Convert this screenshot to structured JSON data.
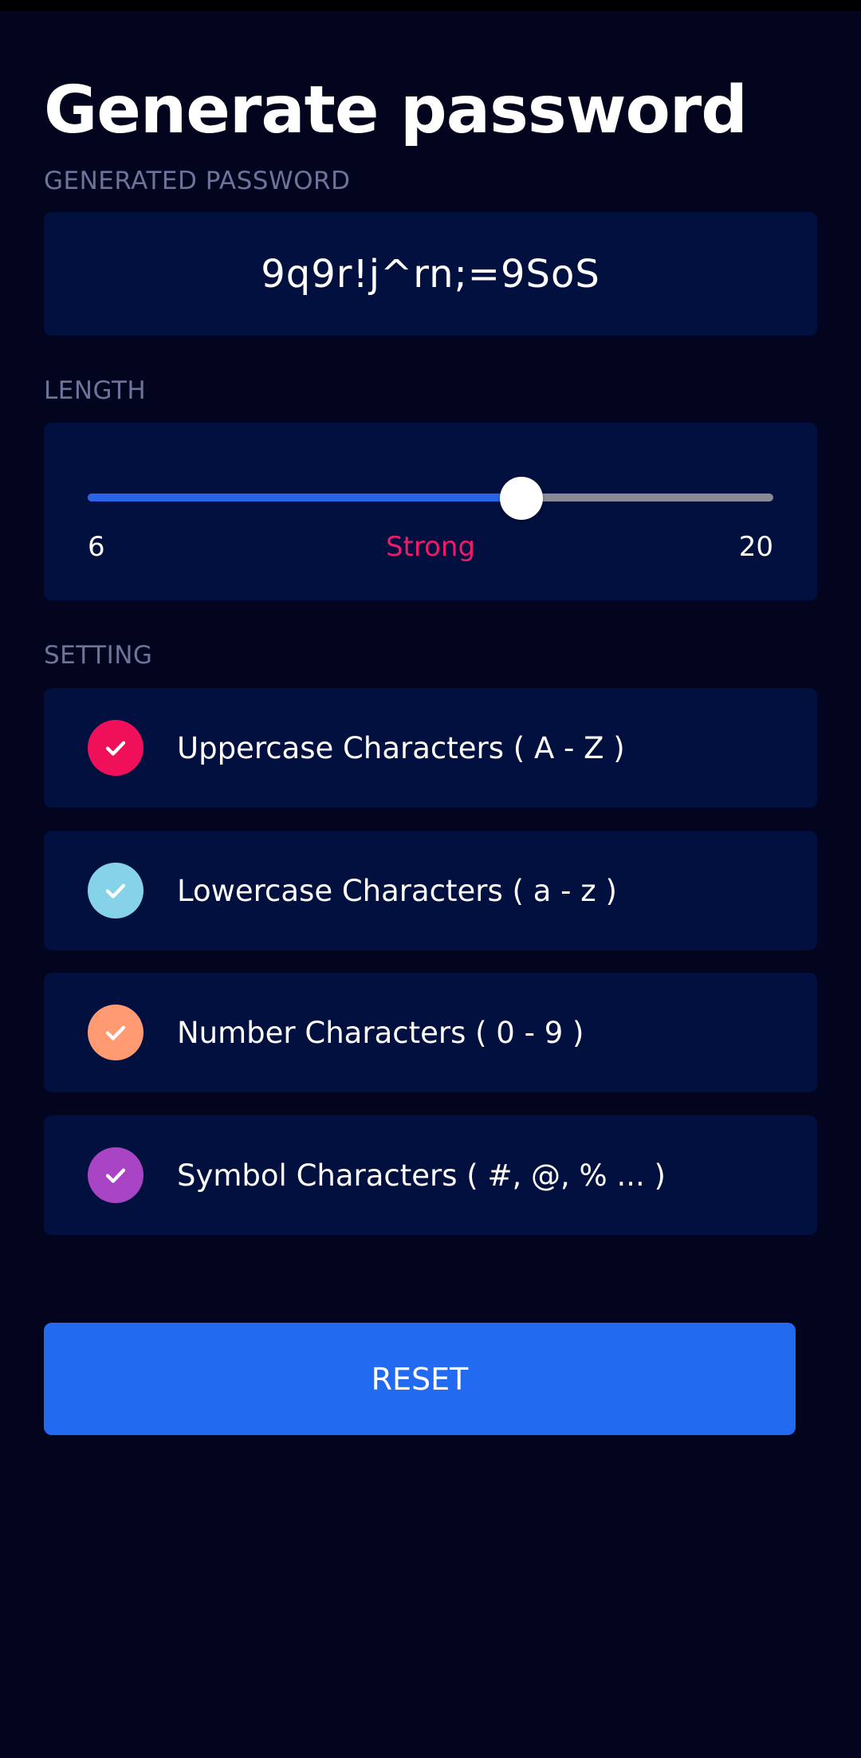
{
  "title": "Generate password",
  "generated": {
    "label": "GENERATED PASSWORD",
    "password": "9q9r!j^rn;=9SoS"
  },
  "length": {
    "label": "LENGTH",
    "min": "6",
    "max": "20",
    "strength": "Strong",
    "value_fraction": 0.633,
    "strength_color": "#f0196a"
  },
  "setting": {
    "label": "SETTING",
    "items": [
      {
        "label": "Uppercase Characters ( A - Z )",
        "checked": true,
        "color": "#f0105a",
        "icon": "check-icon"
      },
      {
        "label": "Lowercase Characters ( a - z )",
        "checked": true,
        "color": "#86d2e8",
        "icon": "check-icon"
      },
      {
        "label": "Number Characters ( 0 - 9 )",
        "checked": true,
        "color": "#ff9a72",
        "icon": "check-icon"
      },
      {
        "label": "Symbol Characters ( #, @, % ... )",
        "checked": true,
        "color": "#a944c4",
        "icon": "check-icon"
      }
    ]
  },
  "reset_label": "RESET",
  "colors": {
    "background": "#03051f",
    "card": "#02103f",
    "accent": "#226af0",
    "slider_fill": "#2a64e6",
    "section_label": "#6e7399"
  }
}
